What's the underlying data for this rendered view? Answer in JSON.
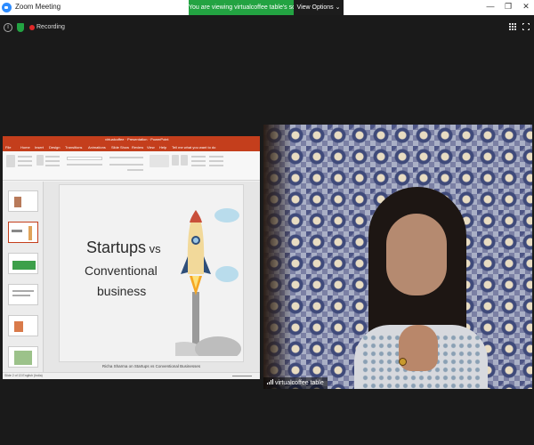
{
  "window": {
    "title": "Zoom Meeting",
    "share_banner": "You are viewing virtualcoffee table's screen",
    "view_options": "View Options ⌄",
    "controls": {
      "minimize": "—",
      "maximize": "❐",
      "close": "✕"
    }
  },
  "meeting_bar": {
    "info_icon": "i",
    "recording_label": "Recording"
  },
  "shared_screen": {
    "app": "PowerPoint",
    "doc_title": "virtualcoffee · Presentation · PowerPoint",
    "tabs": [
      "File",
      "Home",
      "Insert",
      "Design",
      "Transitions",
      "Animations",
      "Slide Show",
      "Review",
      "View",
      "Help",
      "Tell me what you want to do"
    ],
    "slide": {
      "title_main": "Startups",
      "title_vs": " vs",
      "title_line2": "Conventional",
      "title_line3": "business",
      "caption": "Richa Sharma on Startups vs Conventional Businesses"
    },
    "status": "Slide 2 of 13   English (India)"
  },
  "video": {
    "participant_name": "virtualcoffee table"
  },
  "colors": {
    "ppt_accent": "#c43e1c",
    "share_banner": "#23a342",
    "recording": "#e02828"
  }
}
